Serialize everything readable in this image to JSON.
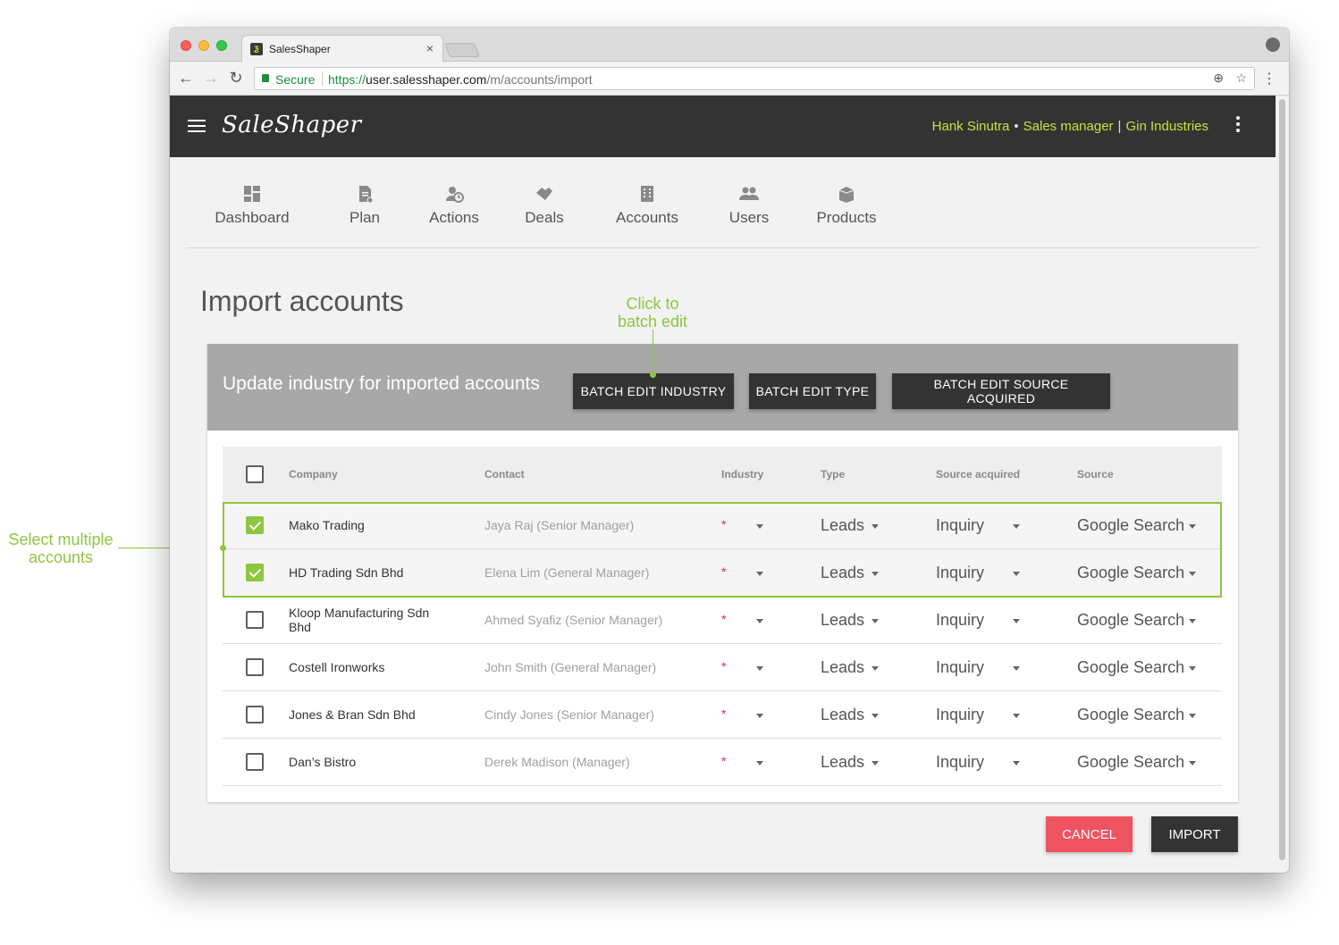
{
  "browser": {
    "tab_title": "SalesShaper",
    "tab_close": "×",
    "secure_label": "Secure",
    "url_scheme": "https://",
    "url_host": "user.salesshaper.com",
    "url_path": "/m/accounts/import",
    "back": "←",
    "forward": "→",
    "reload": "↻",
    "zoom_icon": "⊕",
    "star_icon": "☆",
    "menu_icon": "⋮"
  },
  "header": {
    "logo": "SaleShaper",
    "user_name": "Hank Sinutra",
    "dot": "•",
    "role": "Sales manager",
    "bar": "|",
    "company": "Gin Industries"
  },
  "nav": {
    "items": [
      {
        "label": "Dashboard",
        "icon": "dashboard-icon"
      },
      {
        "label": "Plan",
        "icon": "plan-icon"
      },
      {
        "label": "Actions",
        "icon": "actions-icon"
      },
      {
        "label": "Deals",
        "icon": "deals-icon"
      },
      {
        "label": "Accounts",
        "icon": "accounts-icon"
      },
      {
        "label": "Users",
        "icon": "users-icon"
      },
      {
        "label": "Products",
        "icon": "products-icon"
      }
    ]
  },
  "page": {
    "title": "Import accounts"
  },
  "card": {
    "header_title": "Update industry for imported accounts",
    "batch_industry": "BATCH EDIT INDUSTRY",
    "batch_type": "BATCH EDIT TYPE",
    "batch_source": "BATCH EDIT SOURCE ACQUIRED"
  },
  "table": {
    "columns": {
      "company": "Company",
      "contact": "Contact",
      "industry": "Industry",
      "type": "Type",
      "source_acquired": "Source acquired",
      "source": "Source"
    },
    "required_mark": "*",
    "rows": [
      {
        "company": "Mako Trading",
        "contact": "Jaya Raj (Senior Manager)",
        "type": "Leads",
        "source_acquired": "Inquiry",
        "source": "Google Search",
        "checked": true
      },
      {
        "company": "HD Trading Sdn Bhd",
        "contact": "Elena Lim (General Manager)",
        "type": "Leads",
        "source_acquired": "Inquiry",
        "source": "Google Search",
        "checked": true
      },
      {
        "company": "Kloop Manufacturing Sdn Bhd",
        "contact": "Ahmed Syafiz (Senior Manager)",
        "type": "Leads",
        "source_acquired": "Inquiry",
        "source": "Google Search",
        "checked": false
      },
      {
        "company": "Costell Ironworks",
        "contact": "John Smith (General Manager)",
        "type": "Leads",
        "source_acquired": "Inquiry",
        "source": "Google Search",
        "checked": false
      },
      {
        "company": "Jones & Bran Sdn Bhd",
        "contact": "Cindy Jones (Senior Manager)",
        "type": "Leads",
        "source_acquired": "Inquiry",
        "source": "Google Search",
        "checked": false
      },
      {
        "company": "Dan’s Bistro",
        "contact": "Derek Madison (Manager)",
        "type": "Leads",
        "source_acquired": "Inquiry",
        "source": "Google Search",
        "checked": false
      }
    ]
  },
  "actions": {
    "cancel": "CANCEL",
    "import": "IMPORT"
  },
  "annotations": {
    "batch_line1": "Click to",
    "batch_line2": "batch edit",
    "select_line1": "Select multiple",
    "select_line2": "accounts"
  },
  "colors": {
    "accent_green": "#8dc63f",
    "header_dark": "#333333",
    "user_info": "#c3e53c",
    "cancel_red": "#ef5360"
  }
}
